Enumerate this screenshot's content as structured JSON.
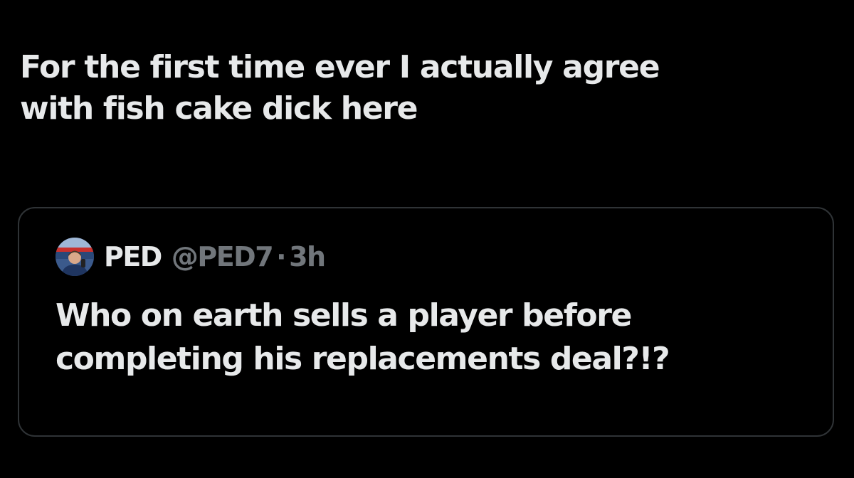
{
  "tweet": {
    "text": "For the first time ever I actually agree\nwith fish cake dick here"
  },
  "quoted_tweet": {
    "display_name": "PED",
    "handle": "@PED7",
    "separator": "·",
    "time": "3h",
    "text": "Who on earth sells a player before\ncompleting his replacements deal?!?",
    "avatar_icon": "profile-photo-avatar"
  },
  "colors": {
    "background": "#000000",
    "primary_text": "#e7e9ea",
    "secondary_text": "#71767b",
    "card_border": "#2f3336"
  }
}
